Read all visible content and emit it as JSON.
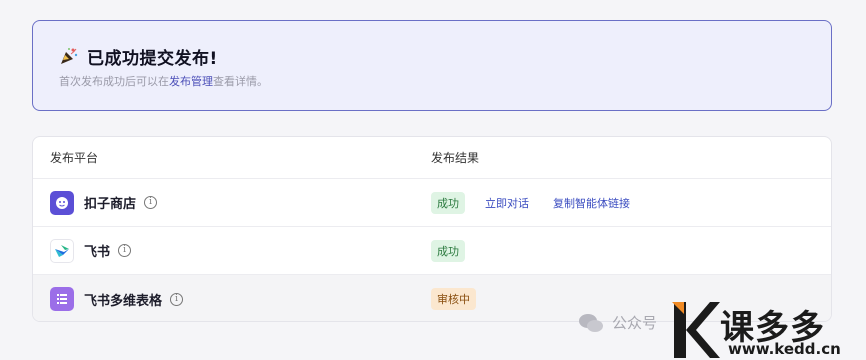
{
  "banner": {
    "icon": "party-popper-icon",
    "title": "已成功提交发布!",
    "sub_prefix": "首次发布成功后可以在",
    "sub_link": "发布管理",
    "sub_suffix": "查看详情。"
  },
  "table": {
    "headers": [
      "发布平台",
      "发布结果"
    ],
    "rows": [
      {
        "icon": "kouzi-store-icon",
        "name": "扣子商店",
        "status": "成功",
        "status_color": "#2c7a3f",
        "actions": [
          "立即对话",
          "复制智能体链接"
        ]
      },
      {
        "icon": "feishu-icon",
        "name": "飞书",
        "status": "成功",
        "status_color": "#2c7a3f",
        "actions": []
      },
      {
        "icon": "feishu-bitable-icon",
        "name": "飞书多维表格",
        "status": "审核中",
        "status_color": "#8a4f10",
        "actions": []
      }
    ]
  },
  "watermark": {
    "wechat_text": "公众号",
    "brand_text": "课多多",
    "brand_url": "www.kedd.cn"
  }
}
